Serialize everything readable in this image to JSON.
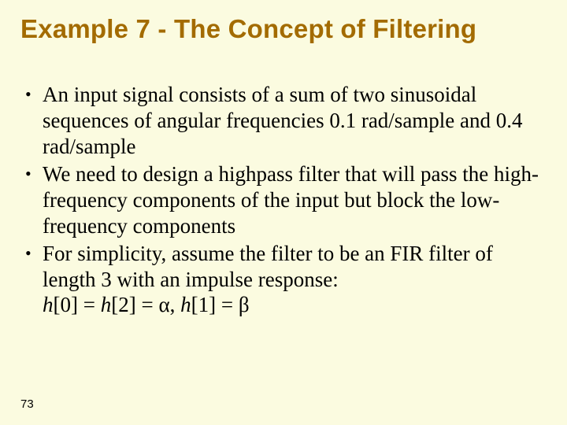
{
  "title": "Example 7 - The Concept of Filtering",
  "bullets": [
    "An input signal consists of a sum of two sinusoidal sequences of angular frequencies 0.1 rad/sample and 0.4 rad/sample",
    "We need to design a highpass filter that will pass the high-frequency components of the input but block the low-frequency components",
    "For simplicity, assume the filter to be an FIR filter of length 3 with an impulse response:"
  ],
  "impulse_response": {
    "var": "h",
    "h0_index": "[0]",
    "h2_index": "[2]",
    "h1_index": "[1]",
    "eq1_text": " = ",
    "alpha": "α",
    "comma": ", ",
    "beta": "β"
  },
  "page_number": "73"
}
